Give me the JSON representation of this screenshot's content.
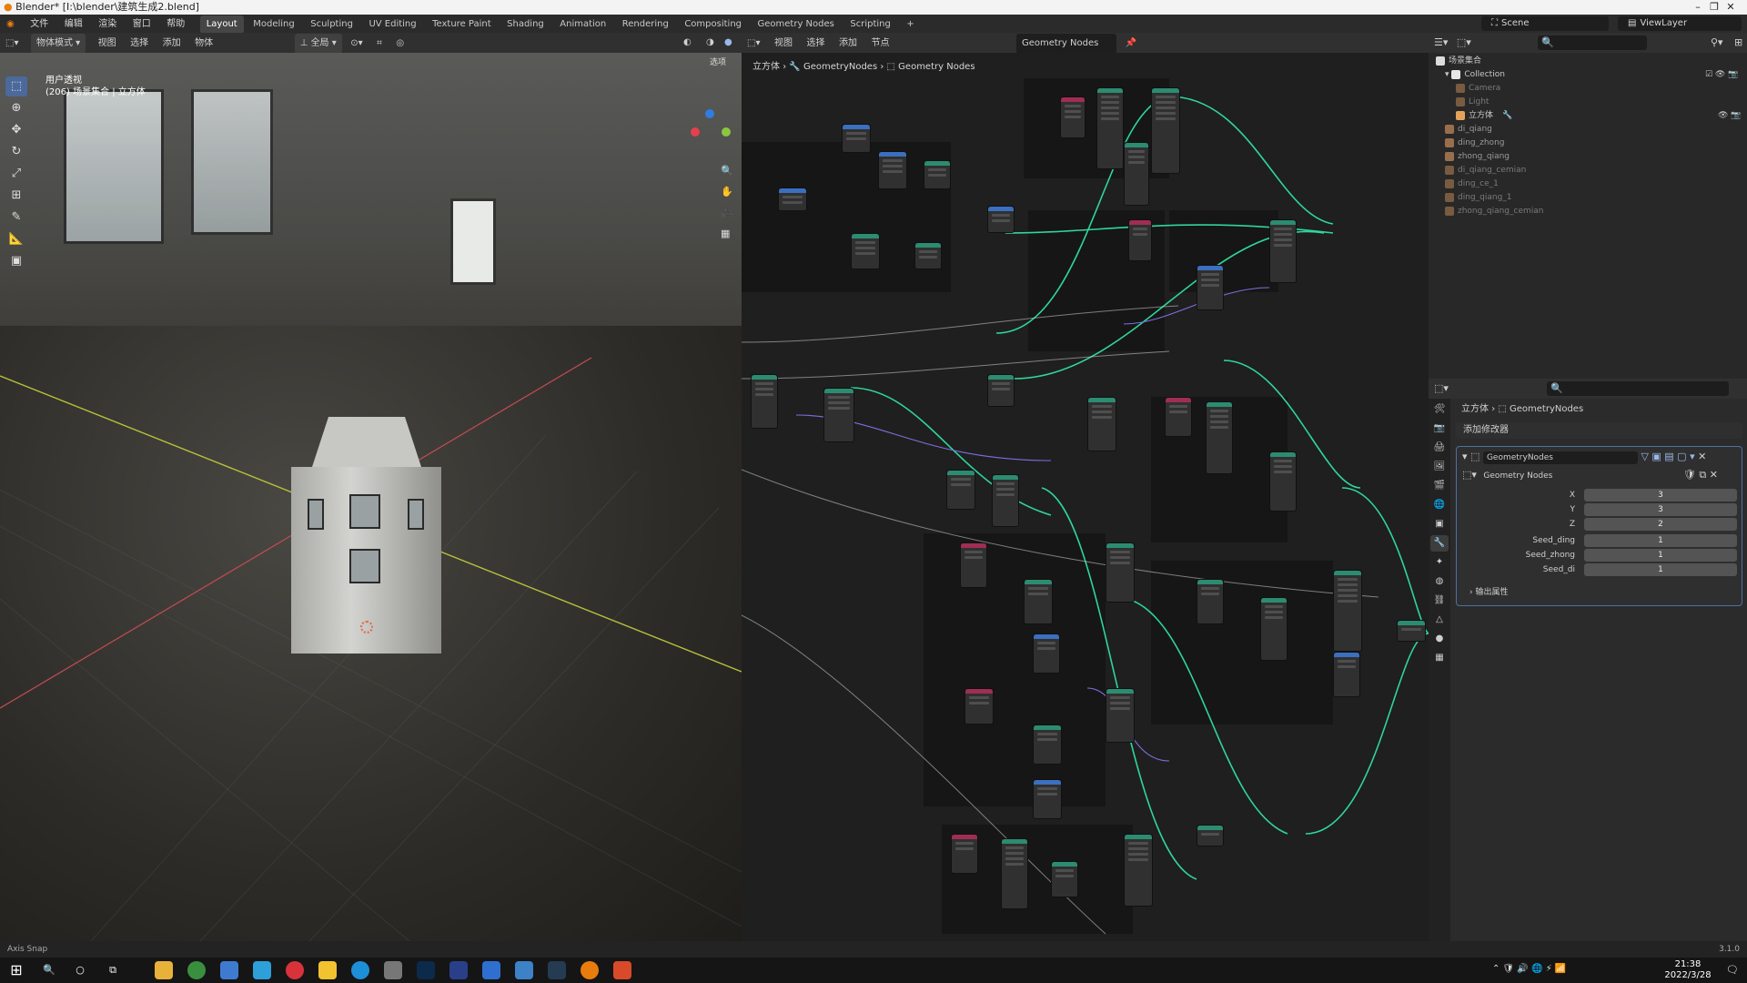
{
  "window": {
    "title": "Blender* [I:\\blender\\建筑生成2.blend]"
  },
  "menus": [
    "文件",
    "编辑",
    "渲染",
    "窗口",
    "帮助"
  ],
  "workspaces": [
    "Layout",
    "Modeling",
    "Sculpting",
    "UV Editing",
    "Texture Paint",
    "Shading",
    "Animation",
    "Rendering",
    "Compositing",
    "Geometry Nodes",
    "Scripting",
    "+"
  ],
  "viewport": {
    "mode": "物体模式",
    "header_menus": [
      "视图",
      "选择",
      "添加",
      "物体"
    ],
    "transform": "全局",
    "options_label": "选项",
    "info_line1": "用户透视",
    "info_line2": "(206) 场景集合 | 立方体"
  },
  "node_editor": {
    "header_menus": [
      "视图",
      "选择",
      "添加",
      "节点"
    ],
    "tree_name": "Geometry Nodes",
    "breadcrumb": [
      "立方体",
      "GeometryNodes",
      "Geometry Nodes"
    ]
  },
  "topright": {
    "scene": "Scene",
    "view_layer": "ViewLayer"
  },
  "outliner": {
    "root": "场景集合",
    "items": [
      {
        "name": "Collection",
        "level": 1
      },
      {
        "name": "Camera",
        "level": 2
      },
      {
        "name": "Light",
        "level": 2
      },
      {
        "name": "立方体",
        "level": 2
      },
      {
        "name": "di_qiang",
        "level": 1
      },
      {
        "name": "ding_zhong",
        "level": 1
      },
      {
        "name": "zhong_qiang",
        "level": 1
      },
      {
        "name": "di_qiang_cemian",
        "level": 1
      },
      {
        "name": "ding_ce_1",
        "level": 1
      },
      {
        "name": "ding_qiang_1",
        "level": 1
      },
      {
        "name": "zhong_qiang_cemian",
        "level": 1
      }
    ]
  },
  "properties": {
    "breadcrumb": [
      "立方体",
      "GeometryNodes"
    ],
    "add_modifier": "添加修改器",
    "modifier_name": "GeometryNodes",
    "node_group": "Geometry Nodes",
    "inputs": [
      {
        "label": "X",
        "value": "3"
      },
      {
        "label": "Y",
        "value": "3"
      },
      {
        "label": "Z",
        "value": "2"
      },
      {
        "label": "Seed_ding",
        "value": "1"
      },
      {
        "label": "Seed_zhong",
        "value": "1"
      },
      {
        "label": "Seed_di",
        "value": "1"
      }
    ],
    "output_attrs": "输出属性"
  },
  "status": {
    "left": "Axis Snap",
    "version": "3.1.0"
  },
  "taskbar": {
    "time": "21:38",
    "date": "2022/3/28"
  },
  "colors": {
    "accent": "#4b6a9b",
    "node_link": "#2fd69a",
    "selection": "#4d70a7"
  }
}
